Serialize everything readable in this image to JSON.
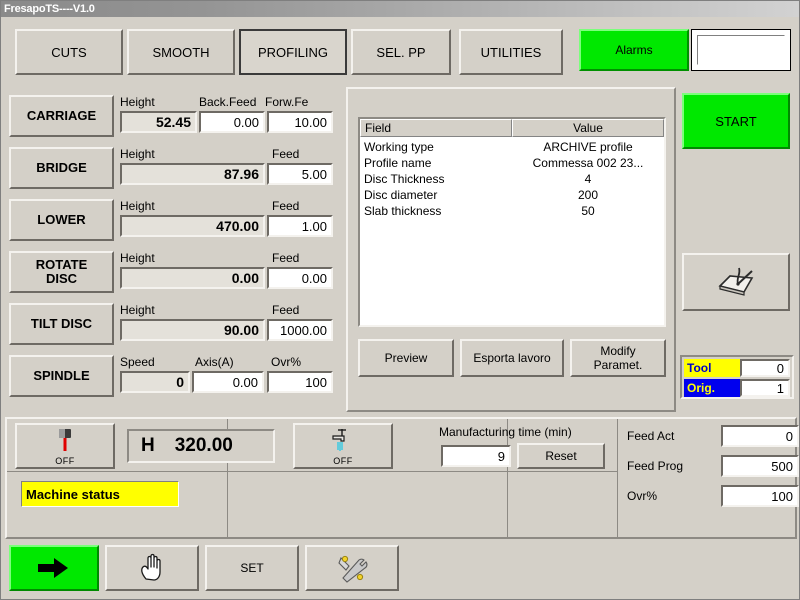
{
  "window": {
    "title": "FresapoTS----V1.0"
  },
  "tabs": [
    {
      "label": "CUTS",
      "active": false
    },
    {
      "label": "SMOOTH",
      "active": false
    },
    {
      "label": "PROFILING",
      "active": true
    },
    {
      "label": "SEL. PP",
      "active": false
    },
    {
      "label": "UTILITIES",
      "active": false
    }
  ],
  "alarms": {
    "label": "Alarms",
    "value": "",
    "color": "#00e800"
  },
  "axes": [
    {
      "name": "CARRIAGE",
      "columns": [
        "Height",
        "Back.Feed",
        "Forw.Fe"
      ],
      "values": [
        "52.45",
        "0.00",
        "10.00"
      ]
    },
    {
      "name": "BRIDGE",
      "columns": [
        "Height",
        "Feed"
      ],
      "values": [
        "87.96",
        "5.00"
      ]
    },
    {
      "name": "LOWER",
      "columns": [
        "Height",
        "Feed"
      ],
      "values": [
        "470.00",
        "1.00"
      ]
    },
    {
      "name": "ROTATE\nDISC",
      "columns": [
        "Height",
        "Feed"
      ],
      "values": [
        "0.00",
        "0.00"
      ]
    },
    {
      "name": "TILT DISC",
      "columns": [
        "Height",
        "Feed"
      ],
      "values": [
        "90.00",
        "1000.00"
      ]
    },
    {
      "name": "SPINDLE",
      "columns": [
        "Speed",
        "Axis(A)",
        "Ovr%"
      ],
      "values": [
        "0",
        "0.00",
        "100"
      ]
    }
  ],
  "axis_labels": {
    "carriage_name": "CARRIAGE",
    "carriage_c0": "Height",
    "carriage_c1": "Back.Feed",
    "carriage_c2": "Forw.Fe",
    "carriage_v0": "52.45",
    "carriage_v1": "0.00",
    "carriage_v2": "10.00",
    "bridge_name": "BRIDGE",
    "bridge_c0": "Height",
    "bridge_c1": "Feed",
    "bridge_v0": "87.96",
    "bridge_v1": "5.00",
    "lower_name": "LOWER",
    "lower_c0": "Height",
    "lower_c1": "Feed",
    "lower_v0": "470.00",
    "lower_v1": "1.00",
    "rotate_name1": "ROTATE",
    "rotate_name2": "DISC",
    "rotate_c0": "Height",
    "rotate_c1": "Feed",
    "rotate_v0": "0.00",
    "rotate_v1": "0.00",
    "tilt_name": "TILT DISC",
    "tilt_c0": "Height",
    "tilt_c1": "Feed",
    "tilt_v0": "90.00",
    "tilt_v1": "1000.00",
    "spindle_name": "SPINDLE",
    "spindle_c0": "Speed",
    "spindle_c1": "Axis(A)",
    "spindle_c2": "Ovr%",
    "spindle_v0": "0",
    "spindle_v1": "0.00",
    "spindle_v2": "100"
  },
  "job_table": {
    "headers": {
      "field": "Field",
      "value": "Value"
    },
    "rows": [
      {
        "field": "Working type",
        "value": "ARCHIVE profile"
      },
      {
        "field": "Profile name",
        "value": "Commessa 002 23..."
      },
      {
        "field": "Disc Thickness",
        "value": "4"
      },
      {
        "field": "Disc diameter",
        "value": "200"
      },
      {
        "field": "Slab thickness",
        "value": "50"
      }
    ]
  },
  "center_buttons": {
    "preview": "Preview",
    "export": "Esporta lavoro",
    "modify_line1": "Modify",
    "modify_line2": "Paramet."
  },
  "right_panel": {
    "start": "START",
    "engrave_icon": "slab-engraving-icon",
    "tool_label": "Tool",
    "tool_value": "0",
    "orig_label": "Orig.",
    "orig_value": "1",
    "tool_bg": "#ffff00",
    "tool_fg": "#0000c8",
    "orig_bg": "#0000ee",
    "orig_fg": "#ffff00"
  },
  "status": {
    "spindle_icon_label": "OFF",
    "height_prefix": "H",
    "height_value": "320.00",
    "water_icon_label": "OFF",
    "manufacturing_time_label": "Manufacturing time (min)",
    "manufacturing_time_value": "9",
    "reset_label": "Reset",
    "machine_status": "Machine status",
    "feed_act_label": "Feed Act",
    "feed_act_value": "0",
    "feed_prog_label": "Feed Prog",
    "feed_prog_value": "500",
    "ovr_label": "Ovr%",
    "ovr_value": "100"
  },
  "toolbar": {
    "run_icon": "arrow-into-box-icon",
    "manual_icon": "hand-icon",
    "set_label": "SET",
    "tools_icon": "wrench-screwdriver-icon"
  }
}
